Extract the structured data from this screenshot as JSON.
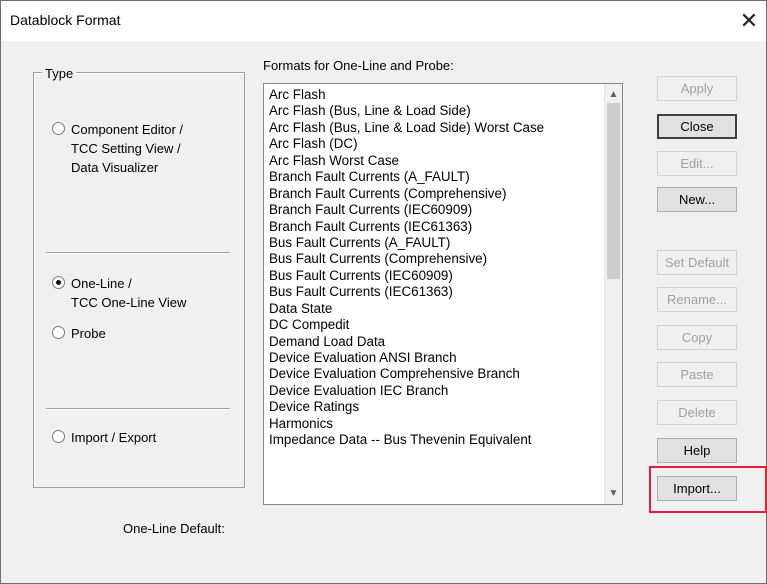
{
  "window": {
    "title": "Datablock Format",
    "close_glyph": "✕"
  },
  "type_group": {
    "legend": "Type",
    "options": [
      {
        "label_lines": [
          "Component Editor /",
          "TCC Setting View /",
          "Data Visualizer"
        ],
        "selected": false
      },
      {
        "label_lines": [
          "One-Line /",
          "TCC One-Line View"
        ],
        "selected": true
      },
      {
        "label_lines": [
          "Probe"
        ],
        "selected": false
      },
      {
        "label_lines": [
          "Import / Export"
        ],
        "selected": false
      }
    ]
  },
  "formats": {
    "label": "Formats for One-Line and Probe:",
    "items": [
      "Arc Flash",
      "Arc Flash (Bus, Line & Load Side)",
      "Arc Flash (Bus, Line & Load Side) Worst Case",
      "Arc Flash (DC)",
      "Arc Flash Worst Case",
      "Branch Fault Currents (A_FAULT)",
      "Branch Fault Currents (Comprehensive)",
      "Branch Fault Currents (IEC60909)",
      "Branch Fault Currents (IEC61363)",
      "Bus Fault Currents (A_FAULT)",
      "Bus Fault Currents (Comprehensive)",
      "Bus Fault Currents (IEC60909)",
      "Bus Fault Currents (IEC61363)",
      "Data State",
      "DC Compedit",
      "Demand Load Data",
      "Device Evaluation ANSI Branch",
      "Device Evaluation Comprehensive Branch",
      "Device Evaluation IEC Branch",
      "Device Ratings",
      "Harmonics",
      "Impedance Data -- Bus Thevenin Equivalent"
    ]
  },
  "default_label": "One-Line Default:",
  "buttons": {
    "apply": "Apply",
    "close": "Close",
    "edit": "Edit...",
    "new": "New...",
    "set_default": "Set Default",
    "rename": "Rename...",
    "copy": "Copy",
    "paste": "Paste",
    "delete": "Delete",
    "help": "Help",
    "import": "Import..."
  },
  "colors": {
    "highlight": "#e81d3a"
  }
}
